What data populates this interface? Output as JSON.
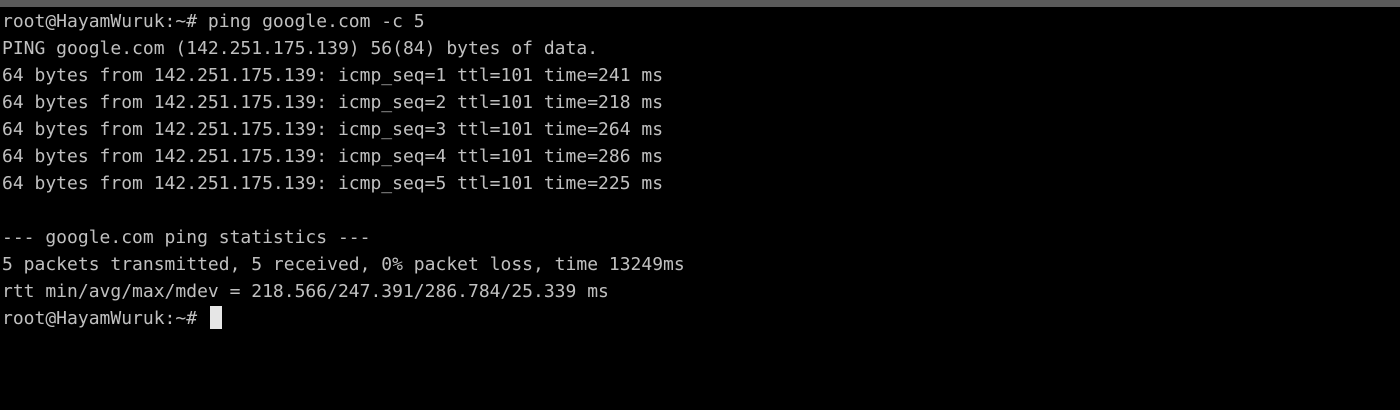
{
  "terminal": {
    "lines": [
      "root@HayamWuruk:~# ping google.com -c 5",
      "PING google.com (142.251.175.139) 56(84) bytes of data.",
      "64 bytes from 142.251.175.139: icmp_seq=1 ttl=101 time=241 ms",
      "64 bytes from 142.251.175.139: icmp_seq=2 ttl=101 time=218 ms",
      "64 bytes from 142.251.175.139: icmp_seq=3 ttl=101 time=264 ms",
      "64 bytes from 142.251.175.139: icmp_seq=4 ttl=101 time=286 ms",
      "64 bytes from 142.251.175.139: icmp_seq=5 ttl=101 time=225 ms",
      "",
      "--- google.com ping statistics ---",
      "5 packets transmitted, 5 received, 0% packet loss, time 13249ms",
      "rtt min/avg/max/mdev = 218.566/247.391/286.784/25.339 ms"
    ],
    "prompt": "root@HayamWuruk:~# ",
    "colors": {
      "background": "#000000",
      "foreground": "#c0c0c0",
      "cursor": "#e6e6e6",
      "title_strip": "#5a5a5a"
    }
  }
}
